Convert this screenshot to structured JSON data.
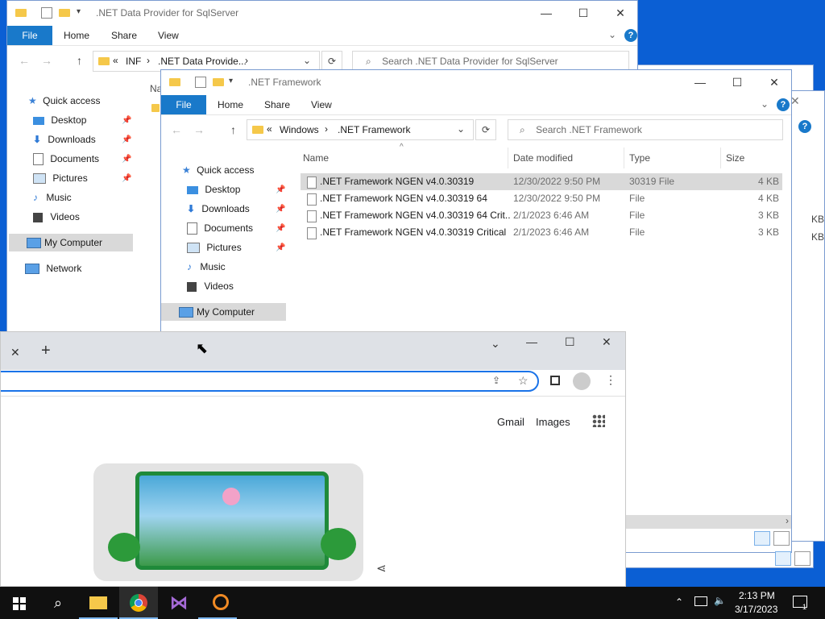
{
  "back_window": {
    "title": ".NET Data Provider for SqlServer",
    "ribbon": {
      "file": "File",
      "home": "Home",
      "share": "Share",
      "view": "View"
    },
    "address": {
      "prefix": "«",
      "crumb1": "INF",
      "sep": "›",
      "crumb2": ".NET Data Provide...",
      "sep2": "›"
    },
    "search_placeholder": "Search .NET Data Provider for SqlServer",
    "nav_fragment": "Na",
    "nav": {
      "quick_access": "Quick access",
      "items": [
        {
          "label": "Desktop"
        },
        {
          "label": "Downloads"
        },
        {
          "label": "Documents"
        },
        {
          "label": "Pictures"
        },
        {
          "label": "Music"
        },
        {
          "label": "Videos"
        }
      ],
      "my_computer": "My Computer",
      "network": "Network"
    },
    "edge_fragments": {
      "kb1": "KB",
      "kb2": "KB"
    }
  },
  "front_window": {
    "title": ".NET Framework",
    "ribbon": {
      "file": "File",
      "home": "Home",
      "share": "Share",
      "view": "View"
    },
    "address": {
      "prefix": "«",
      "crumb1": "Windows",
      "sep": "›",
      "crumb2": ".NET Framework"
    },
    "search_placeholder": "Search .NET Framework",
    "nav": {
      "quick_access": "Quick access",
      "items": [
        {
          "label": "Desktop"
        },
        {
          "label": "Downloads"
        },
        {
          "label": "Documents"
        },
        {
          "label": "Pictures"
        },
        {
          "label": "Music"
        },
        {
          "label": "Videos"
        }
      ],
      "my_computer": "My Computer"
    },
    "columns": {
      "name": "Name",
      "date": "Date modified",
      "type": "Type",
      "size": "Size"
    },
    "files": [
      {
        "name": ".NET Framework NGEN v4.0.30319",
        "date": "12/30/2022 9:50 PM",
        "type": "30319 File",
        "size": "4 KB"
      },
      {
        "name": ".NET Framework NGEN v4.0.30319 64",
        "date": "12/30/2022 9:50 PM",
        "type": "File",
        "size": "4 KB"
      },
      {
        "name": ".NET Framework NGEN v4.0.30319 64 Crit...",
        "date": "2/1/2023 6:46 AM",
        "type": "File",
        "size": "3 KB"
      },
      {
        "name": ".NET Framework NGEN v4.0.30319 Critical",
        "date": "2/1/2023 6:46 AM",
        "type": "File",
        "size": "3 KB"
      }
    ]
  },
  "browser": {
    "tab_close": "✕",
    "new_tab": "+",
    "links": {
      "gmail": "Gmail",
      "images": "Images"
    }
  },
  "taskbar": {
    "time": "2:13 PM",
    "date": "3/17/2023",
    "notif_count": "1"
  },
  "colors": {
    "accent": "#1979ca",
    "desktop": "#0b5fd4",
    "taskbar": "#101010"
  }
}
